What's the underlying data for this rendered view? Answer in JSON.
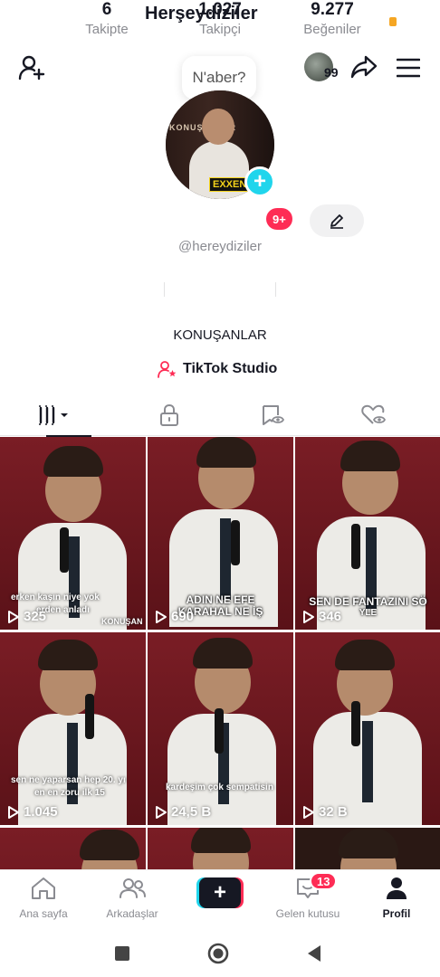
{
  "status": {
    "indicator_color": "#f5a623"
  },
  "header": {
    "friends_count": "99",
    "add_friend_icon": "person-add-icon",
    "share_icon": "share-arrow-icon",
    "menu_icon": "hamburger-menu-icon"
  },
  "profile": {
    "note_bubble": "N'aber?",
    "photo_logo": "EXXEN",
    "photo_sign": "KONUŞANLAR",
    "display_name": "Herşeydiziler",
    "name_badge": "9+",
    "username": "@hereydiziler",
    "bio": "KONUŞANLAR",
    "studio_label": "TikTok Studio"
  },
  "stats": [
    {
      "value": "6",
      "label": "Takipte"
    },
    {
      "value": "1.027",
      "label": "Takipçi"
    },
    {
      "value": "9.277",
      "label": "Beğeniler"
    }
  ],
  "tabs": [
    {
      "name": "videos-tab",
      "icon": "grid-columns-icon",
      "active": true
    },
    {
      "name": "private-tab",
      "icon": "lock-icon"
    },
    {
      "name": "reposts-tab",
      "icon": "repost-eye-icon"
    },
    {
      "name": "liked-tab",
      "icon": "heart-eye-icon"
    }
  ],
  "videos": [
    {
      "views": "325",
      "caption_line1": "erken kaşın niye yok",
      "caption_line2": "erden anladı",
      "caption_sign": "KONUŞAN"
    },
    {
      "views": "690",
      "caption_line1": "ADIN NE EFE",
      "caption_line2": "KARAHAL NE İŞ"
    },
    {
      "views": "346",
      "caption_line1": "SEN DE FANTAZINI SÖ",
      "caption_line2": "YLE"
    },
    {
      "views": "1.045",
      "caption_line1": "sen ne yaparsan hep 20. yı",
      "caption_line2": "en en zoru ilk 15"
    },
    {
      "views": "24,5 B",
      "caption_line1": "kardeşim çok sempatisin",
      "caption_line2": ""
    },
    {
      "views": "32 B",
      "caption_line1": "",
      "caption_line2": ""
    }
  ],
  "bottom_nav": {
    "home": "Ana sayfa",
    "friends": "Arkadaşlar",
    "create": "+",
    "inbox": "Gelen kutusu",
    "inbox_badge": "13",
    "profile": "Profil"
  },
  "colors": {
    "accent": "#fe2c55",
    "cyan": "#20d5ec",
    "text": "#161823",
    "muted": "#8a8b91"
  }
}
